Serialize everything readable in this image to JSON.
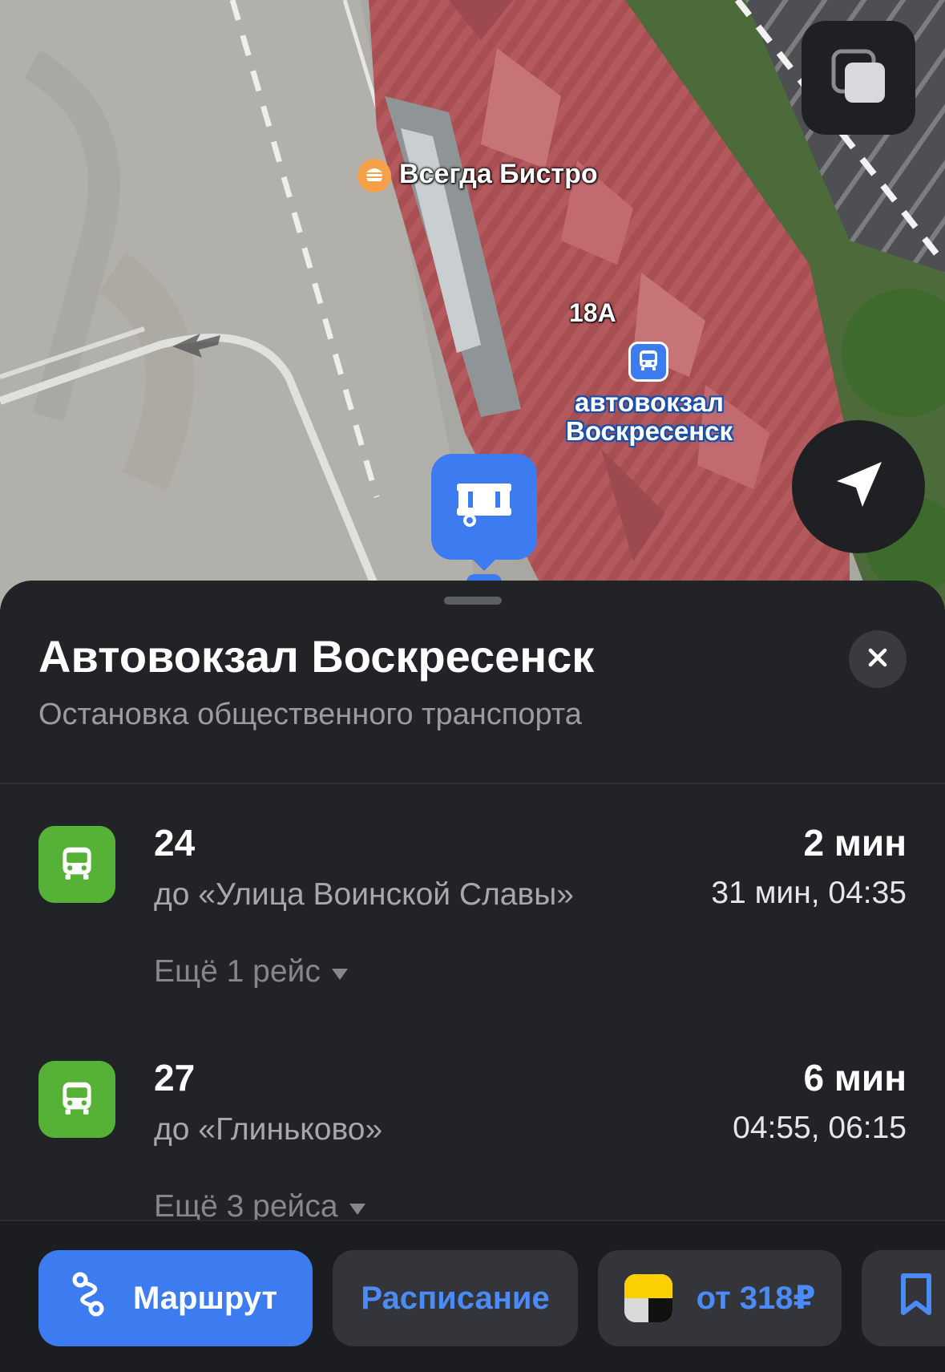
{
  "map": {
    "poi_label": "Всегда Бистро",
    "house_number": "18А",
    "stop_label_line1": "автовокзал",
    "stop_label_line2": "Воскресенск",
    "layers_icon": "layers-icon",
    "location_icon": "navigation-arrow-icon",
    "pin_icon": "bus-station-icon",
    "poi_icon": "burger-icon"
  },
  "sheet": {
    "title": "Автовокзал Воскресенск",
    "subtitle": "Остановка общественного транспорта",
    "close_icon": "close-icon"
  },
  "routes": [
    {
      "number": "24",
      "destination": "до «Улица Воинской Славы»",
      "eta": "2 мин",
      "next": "31 мин, 04:35",
      "more": "Ещё 1 рейс",
      "icon": "bus-icon",
      "icon_color": "#55b236"
    },
    {
      "number": "27",
      "destination": "до «Глиньково»",
      "eta": "6 мин",
      "next": "04:55, 06:15",
      "more": "Ещё 3 рейса",
      "icon": "bus-icon",
      "icon_color": "#55b236"
    }
  ],
  "actions": {
    "route_label": "Маршрут",
    "schedule_label": "Расписание",
    "taxi_label": "от 318₽",
    "route_icon": "route-icon",
    "taxi_icon": "yandex-taxi-icon",
    "bookmark_icon": "bookmark-icon"
  },
  "colors": {
    "accent_blue": "#3d7cf0",
    "link_blue": "#4c8bf5",
    "bus_green": "#55b236",
    "sheet_bg": "#222327"
  }
}
